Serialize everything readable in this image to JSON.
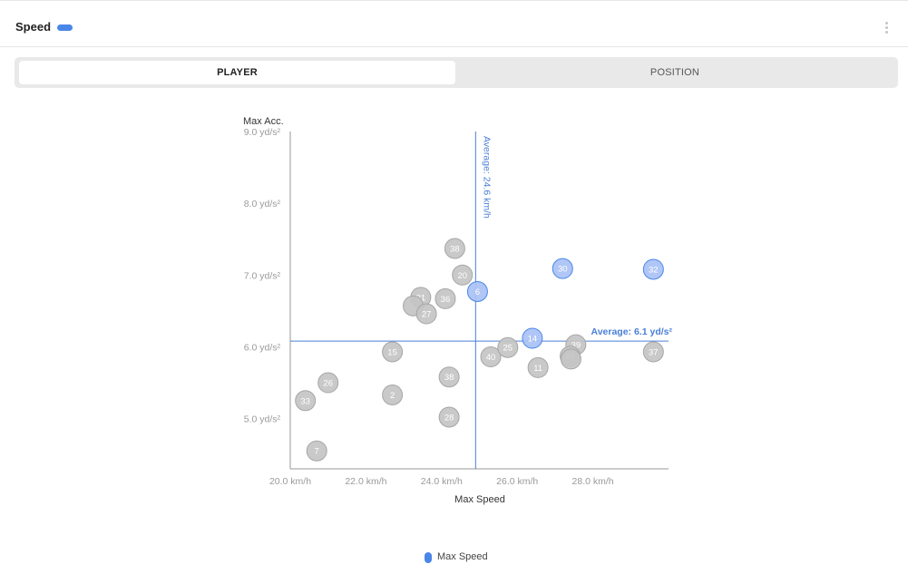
{
  "header": {
    "title": "Speed",
    "menu_icon": "kebab-menu-icon"
  },
  "tabs": [
    {
      "label": "PLAYER",
      "active": true
    },
    {
      "label": "POSITION",
      "active": false
    }
  ],
  "colors": {
    "accent": "#4a86e8",
    "highlight_fill": "#a9c1f5",
    "normal_fill": "#c4c4c4",
    "normal_stroke": "#a6a6a6",
    "axis": "#9a9a9a",
    "avg_line": "#4a7fd8"
  },
  "chart_data": {
    "type": "scatter",
    "ylabel": "Max Acc.",
    "xlabel": "Max Speed",
    "xlim": [
      20,
      30
    ],
    "ylim": [
      4.3,
      9.0
    ],
    "x_ticks": [
      20,
      22,
      24,
      26,
      28
    ],
    "x_tick_labels": [
      "20.0 km/h",
      "22.0 km/h",
      "24.0 km/h",
      "26.0 km/h",
      "28.0 km/h"
    ],
    "y_ticks": [
      5,
      6,
      7,
      8,
      9
    ],
    "y_tick_labels": [
      "5.0 yd/s²",
      "6.0 yd/s²",
      "7.0 yd/s²",
      "8.0 yd/s²",
      "9.0 yd/s²"
    ],
    "avg_x": {
      "value": 24.9,
      "label": "Average: 24.6 km/h"
    },
    "avg_y": {
      "value": 6.08,
      "label": "Average: 6.1 yd/s²"
    },
    "legend": [
      {
        "name": "Max Speed",
        "color": "#4a86e8"
      }
    ],
    "points": [
      {
        "label": "7",
        "x": 20.7,
        "y": 4.55,
        "highlight": false
      },
      {
        "label": "33",
        "x": 20.4,
        "y": 5.25,
        "highlight": false
      },
      {
        "label": "26",
        "x": 21.0,
        "y": 5.5,
        "highlight": false
      },
      {
        "label": "2",
        "x": 22.7,
        "y": 5.33,
        "highlight": false
      },
      {
        "label": "15",
        "x": 22.7,
        "y": 5.93,
        "highlight": false
      },
      {
        "label": "28",
        "x": 24.2,
        "y": 5.02,
        "highlight": false
      },
      {
        "label": "38",
        "x": 24.2,
        "y": 5.58,
        "highlight": false
      },
      {
        "label": "21",
        "x": 23.45,
        "y": 6.69,
        "highlight": false
      },
      {
        "label": "",
        "x": 23.25,
        "y": 6.57,
        "highlight": false
      },
      {
        "label": "27",
        "x": 23.6,
        "y": 6.46,
        "highlight": false
      },
      {
        "label": "36",
        "x": 24.1,
        "y": 6.67,
        "highlight": false
      },
      {
        "label": "20",
        "x": 24.55,
        "y": 7.0,
        "highlight": false
      },
      {
        "label": "38",
        "x": 24.35,
        "y": 7.37,
        "highlight": false
      },
      {
        "label": "6",
        "x": 24.95,
        "y": 6.77,
        "highlight": true
      },
      {
        "label": "40",
        "x": 25.3,
        "y": 5.86,
        "highlight": false
      },
      {
        "label": "25",
        "x": 25.75,
        "y": 5.99,
        "highlight": false
      },
      {
        "label": "14",
        "x": 26.4,
        "y": 6.12,
        "highlight": true
      },
      {
        "label": "11",
        "x": 26.55,
        "y": 5.71,
        "highlight": false
      },
      {
        "label": "39",
        "x": 27.55,
        "y": 6.03,
        "highlight": false
      },
      {
        "label": "88",
        "x": 27.4,
        "y": 5.87,
        "highlight": false
      },
      {
        "label": "",
        "x": 27.42,
        "y": 5.83,
        "highlight": false
      },
      {
        "label": "30",
        "x": 27.2,
        "y": 7.09,
        "highlight": true
      },
      {
        "label": "32",
        "x": 29.6,
        "y": 7.08,
        "highlight": true
      },
      {
        "label": "37",
        "x": 29.6,
        "y": 5.93,
        "highlight": false
      }
    ]
  }
}
